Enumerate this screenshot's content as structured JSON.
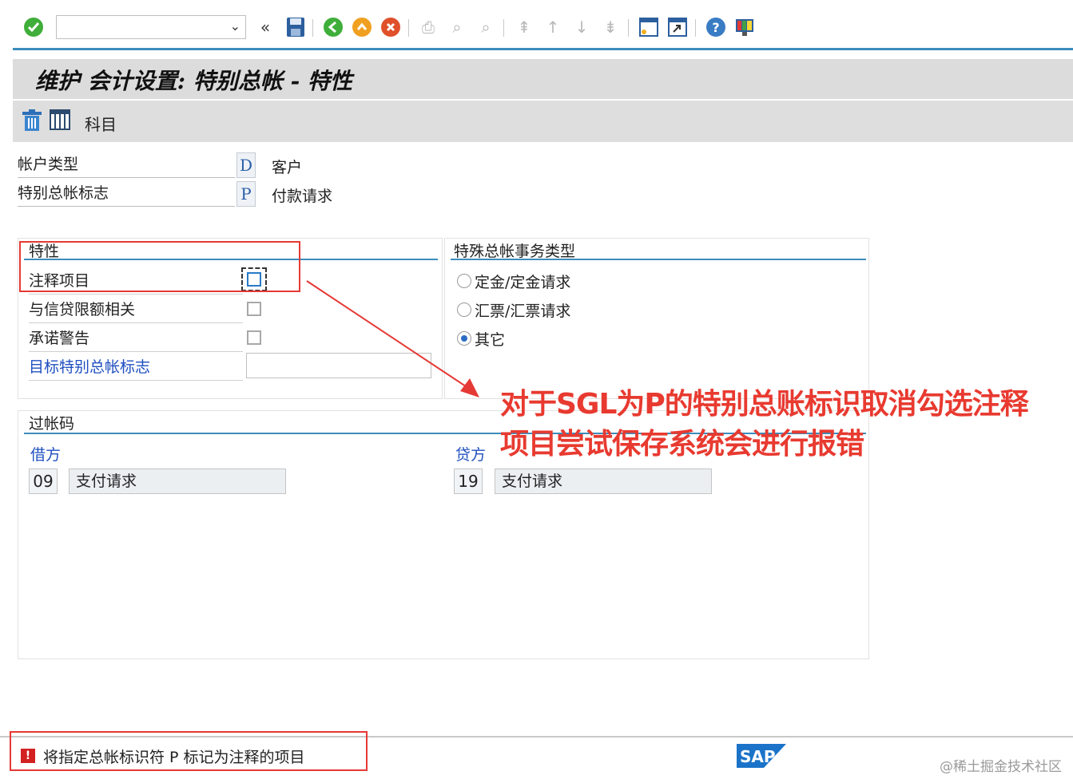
{
  "toolbar": {
    "command_field_value": "",
    "icons": [
      "enter-icon",
      "back-nav-icon",
      "save-icon",
      "back-icon",
      "exit-icon",
      "cancel-icon",
      "print-icon",
      "find-icon",
      "find-next-icon",
      "first-page-icon",
      "prev-page-icon",
      "next-page-icon",
      "last-page-icon",
      "new-session-icon",
      "shortcut-icon",
      "help-icon",
      "customize-layout-icon"
    ]
  },
  "title": "维护 会计设置: 特别总帐 - 特性",
  "app_toolbar": {
    "icons": [
      "delete-icon",
      "table-icon"
    ],
    "accounts_label": "科目"
  },
  "header": {
    "account_type": {
      "label": "帐户类型",
      "code": "D",
      "desc": "客户"
    },
    "sgl_indicator": {
      "label": "特别总帐标志",
      "code": "P",
      "desc": "付款请求"
    }
  },
  "properties": {
    "title": "特性",
    "items": [
      {
        "label": "注释项目",
        "checked": false
      },
      {
        "label": "与信贷限额相关",
        "checked": false
      },
      {
        "label": "承诺警告",
        "checked": false
      }
    ],
    "target_sgl_label": "目标特别总帐标志",
    "target_sgl_value": ""
  },
  "transaction_type": {
    "title": "特殊总帐事务类型",
    "options": [
      "定金/定金请求",
      "汇票/汇票请求",
      "其它"
    ],
    "selected": "其它"
  },
  "posting_keys": {
    "title": "过帐码",
    "debit": {
      "label": "借方",
      "code": "09",
      "desc": "支付请求"
    },
    "credit": {
      "label": "贷方",
      "code": "19",
      "desc": "支付请求"
    }
  },
  "annotation": {
    "line1": "对于SGL为P的特别总账标识取消勾选注释",
    "line2": "项目尝试保存系统会进行报错",
    "color": "#e83a30"
  },
  "status": {
    "type": "error",
    "message": "将指定总帐标识符 P 标记为注释的项目"
  },
  "branding": {
    "logo_text": "SAP",
    "watermark": "@稀土掘金技术社区"
  },
  "colors": {
    "accent": "#3c8dbc",
    "link": "#1f4fc0",
    "error": "#d32020"
  }
}
